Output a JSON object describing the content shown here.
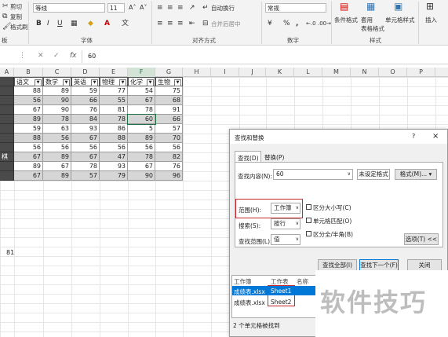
{
  "ribbon": {
    "cut": "剪切",
    "copy": "复制",
    "format_painter": "格式刷",
    "font_name": "等线",
    "font_size": "11",
    "wrap_text": "自动换行",
    "merge_center": "合并后居中",
    "number_format": "常规",
    "conditional_format": "条件格式",
    "format_as_table": "套用\n表格格式",
    "cell_styles": "单元格样式",
    "insert": "插入",
    "groups": {
      "clipboard": "板",
      "font": "字体",
      "alignment": "对齐方式",
      "number": "数字",
      "styles": "样式"
    },
    "bold": "B",
    "italic": "I",
    "underline": "U",
    "percent": "%",
    "comma": ","
  },
  "formula_bar": {
    "fx": "fx",
    "value": "60"
  },
  "columns": [
    "A",
    "B",
    "C",
    "D",
    "E",
    "F",
    "G",
    "H",
    "I",
    "J",
    "K",
    "L",
    "M",
    "N",
    "O",
    "P"
  ],
  "table": {
    "headers": [
      "语文",
      "数学",
      "英语",
      "物理",
      "化学",
      "生物"
    ],
    "rows": [
      [
        88,
        89,
        59,
        77,
        54,
        75
      ],
      [
        56,
        90,
        66,
        55,
        67,
        68
      ],
      [
        67,
        90,
        76,
        81,
        78,
        91
      ],
      [
        89,
        78,
        84,
        78,
        60,
        66
      ],
      [
        59,
        63,
        93,
        86,
        5,
        57
      ],
      [
        88,
        56,
        67,
        88,
        89,
        70
      ],
      [
        56,
        56,
        56,
        56,
        56,
        56
      ],
      [
        67,
        89,
        67,
        47,
        78,
        82
      ],
      [
        89,
        67,
        78,
        93,
        67,
        76
      ],
      [
        67,
        89,
        57,
        79,
        90,
        96
      ]
    ],
    "row_label_fragment": "棋"
  },
  "stray_value": "81",
  "dialog": {
    "title": "查找和替换",
    "help": "?",
    "close": "×",
    "tab_find": "查找(D)",
    "tab_replace": "替换(P)",
    "find_label": "查找内容(N):",
    "find_value": "60",
    "no_format": "未设定格式",
    "format_btn": "格式(M)...",
    "within_label": "范围(H):",
    "within_value": "工作簿",
    "search_label": "搜索(S):",
    "search_value": "按行",
    "lookin_label": "查找范围(L):",
    "lookin_value": "值",
    "match_case": "区分大小写(C)",
    "match_entire": "单元格匹配(O)",
    "match_byte": "区分全/半角(B)",
    "options_btn": "选项(T) <<",
    "find_all": "查找全部(I)",
    "find_next": "查找下一个(F)",
    "close_btn": "关闭",
    "results_headers": [
      "工作簿",
      "工作表",
      "名称"
    ],
    "results": [
      {
        "book": "成绩表.xlsx",
        "sheet": "Sheet1"
      },
      {
        "book": "成绩表.xlsx",
        "sheet": "Sheet2"
      }
    ],
    "status": "2 个单元格被找到"
  },
  "watermark": "软件技巧",
  "colors": {
    "accent": "#217346",
    "highlight_red": "#c8282d",
    "selected_row": "#0078d7"
  }
}
